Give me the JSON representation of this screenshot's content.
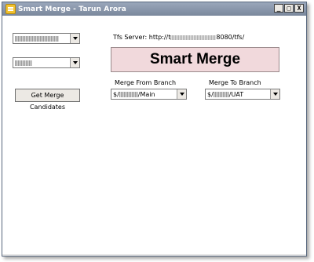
{
  "window": {
    "title": "Smart Merge - Tarun Arora",
    "controls": {
      "minimize": "_",
      "maximize": "□",
      "close": "X"
    }
  },
  "left_panel": {
    "combo1": {
      "selected_value": ""
    },
    "combo2": {
      "selected_value": ""
    },
    "get_candidates_button": "Get Merge Candidates"
  },
  "server": {
    "label": "Tfs Server: http://t",
    "suffix": "8080/tfs/"
  },
  "banner": {
    "title": "Smart Merge"
  },
  "merge_from": {
    "label": "Merge From Branch",
    "prefix": "$/",
    "suffix": "/Main"
  },
  "merge_to": {
    "label": "Merge To Branch",
    "prefix": "$/",
    "suffix": "/UAT"
  },
  "colors": {
    "banner_bg": "#f1d9dc",
    "titlebar": "#8794a9"
  },
  "icons": [
    "app-icon",
    "minimize-icon",
    "maximize-icon",
    "close-icon",
    "chevron-down-icon"
  ]
}
